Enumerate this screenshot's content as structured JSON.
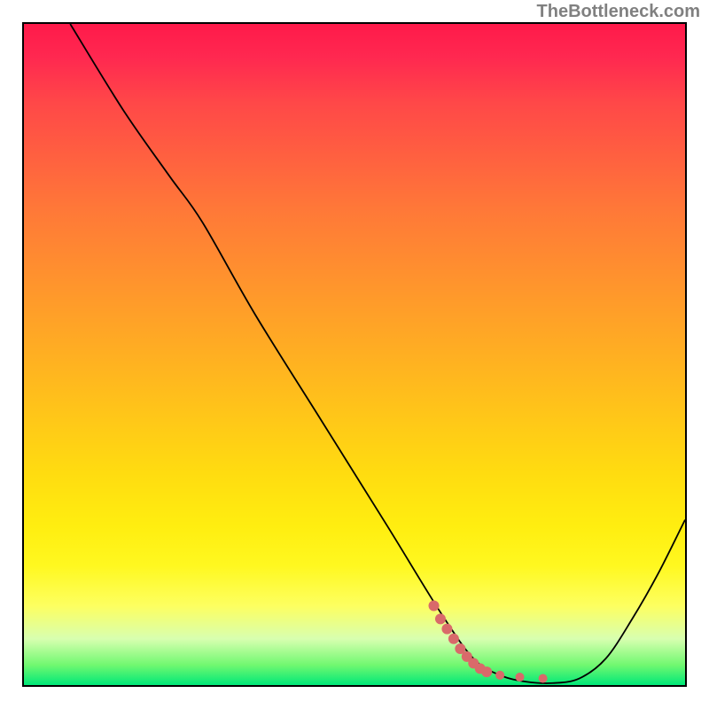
{
  "watermark_text": "TheBottleneck.com",
  "chart_data": {
    "type": "line",
    "title": "",
    "xlabel": "",
    "ylabel": "",
    "xlim": [
      0,
      100
    ],
    "ylim": [
      0,
      100
    ],
    "curve_points": [
      {
        "x": 7,
        "y": 100
      },
      {
        "x": 15,
        "y": 87
      },
      {
        "x": 22,
        "y": 77
      },
      {
        "x": 27,
        "y": 70
      },
      {
        "x": 35,
        "y": 56
      },
      {
        "x": 45,
        "y": 40
      },
      {
        "x": 55,
        "y": 24
      },
      {
        "x": 63,
        "y": 11
      },
      {
        "x": 68,
        "y": 4
      },
      {
        "x": 72,
        "y": 1.5
      },
      {
        "x": 76,
        "y": 0.5
      },
      {
        "x": 80,
        "y": 0.3
      },
      {
        "x": 84,
        "y": 1
      },
      {
        "x": 88,
        "y": 4
      },
      {
        "x": 92,
        "y": 10
      },
      {
        "x": 96,
        "y": 17
      },
      {
        "x": 100,
        "y": 25
      }
    ],
    "highlight_points": [
      {
        "x": 62,
        "y": 12
      },
      {
        "x": 63,
        "y": 10
      },
      {
        "x": 64,
        "y": 8.5
      },
      {
        "x": 65,
        "y": 7
      },
      {
        "x": 66,
        "y": 5.5
      },
      {
        "x": 67,
        "y": 4.3
      },
      {
        "x": 68,
        "y": 3.3
      },
      {
        "x": 69,
        "y": 2.5
      },
      {
        "x": 70,
        "y": 2.0
      },
      {
        "x": 72,
        "y": 1.5
      },
      {
        "x": 75,
        "y": 1.2
      },
      {
        "x": 78.5,
        "y": 1.0
      }
    ],
    "gradient_stops": [
      {
        "pos": 0,
        "color": "#ff1a4a"
      },
      {
        "pos": 50,
        "color": "#ffb420"
      },
      {
        "pos": 100,
        "color": "#00e878"
      }
    ]
  }
}
